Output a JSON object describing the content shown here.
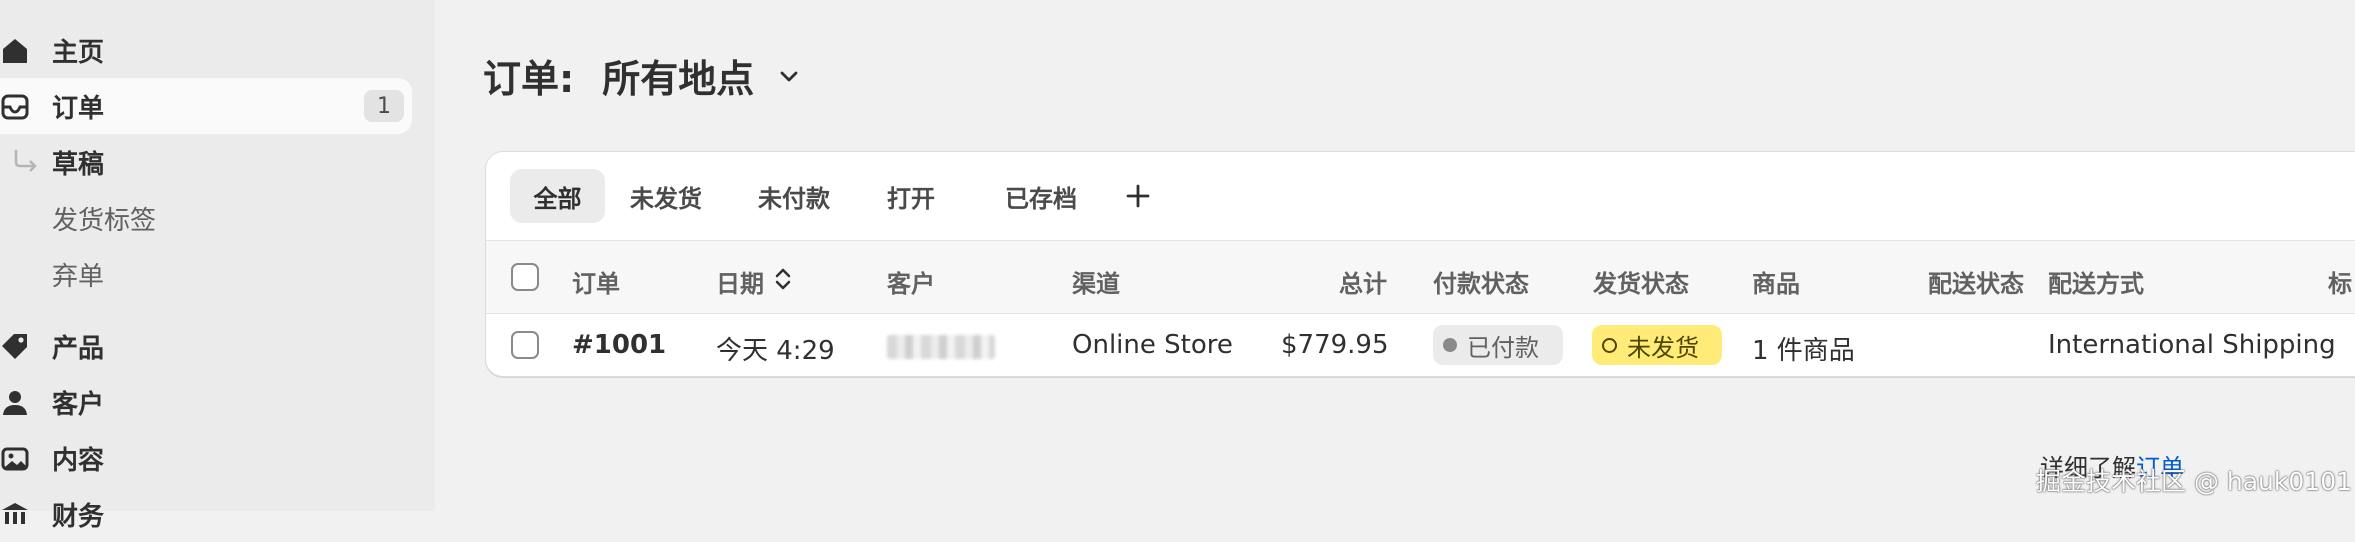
{
  "sidebar": {
    "items": [
      {
        "label": "主页",
        "icon": "home-icon"
      },
      {
        "label": "订单",
        "icon": "inbox-icon",
        "badge": "1"
      },
      {
        "label": "草稿",
        "icon": "subitem-arrow-icon"
      },
      {
        "label": "发货标签"
      },
      {
        "label": "弃单"
      },
      {
        "label": "产品",
        "icon": "tag-icon"
      },
      {
        "label": "客户",
        "icon": "person-icon"
      },
      {
        "label": "内容",
        "icon": "image-icon"
      },
      {
        "label": "财务",
        "icon": "bank-icon"
      }
    ]
  },
  "header": {
    "title": "订单:",
    "location": "所有地点"
  },
  "tabs": [
    {
      "label": "全部"
    },
    {
      "label": "未发货"
    },
    {
      "label": "未付款"
    },
    {
      "label": "打开"
    },
    {
      "label": "已存档"
    }
  ],
  "table": {
    "columns": [
      "订单",
      "日期",
      "客户",
      "渠道",
      "总计",
      "付款状态",
      "发货状态",
      "商品",
      "配送状态",
      "配送方式",
      "标"
    ],
    "rows": [
      {
        "order": "#1001",
        "date": "今天 4:29",
        "customer": "",
        "channel": "Online Store",
        "total": "$779.95",
        "payment_status": "已付款",
        "fulfillment_status": "未发货",
        "items": "1 件商品",
        "delivery_status": "",
        "delivery_method": "International Shipping"
      }
    ]
  },
  "footer": {
    "learn_prefix": "详细了解",
    "learn_link": "订单"
  },
  "watermark": "掘金技术社区 @ hauk0101",
  "colors": {
    "accent_link": "#005bd3",
    "unfulfilled_badge": "#ffeb78",
    "paid_badge": "#ebebeb"
  }
}
